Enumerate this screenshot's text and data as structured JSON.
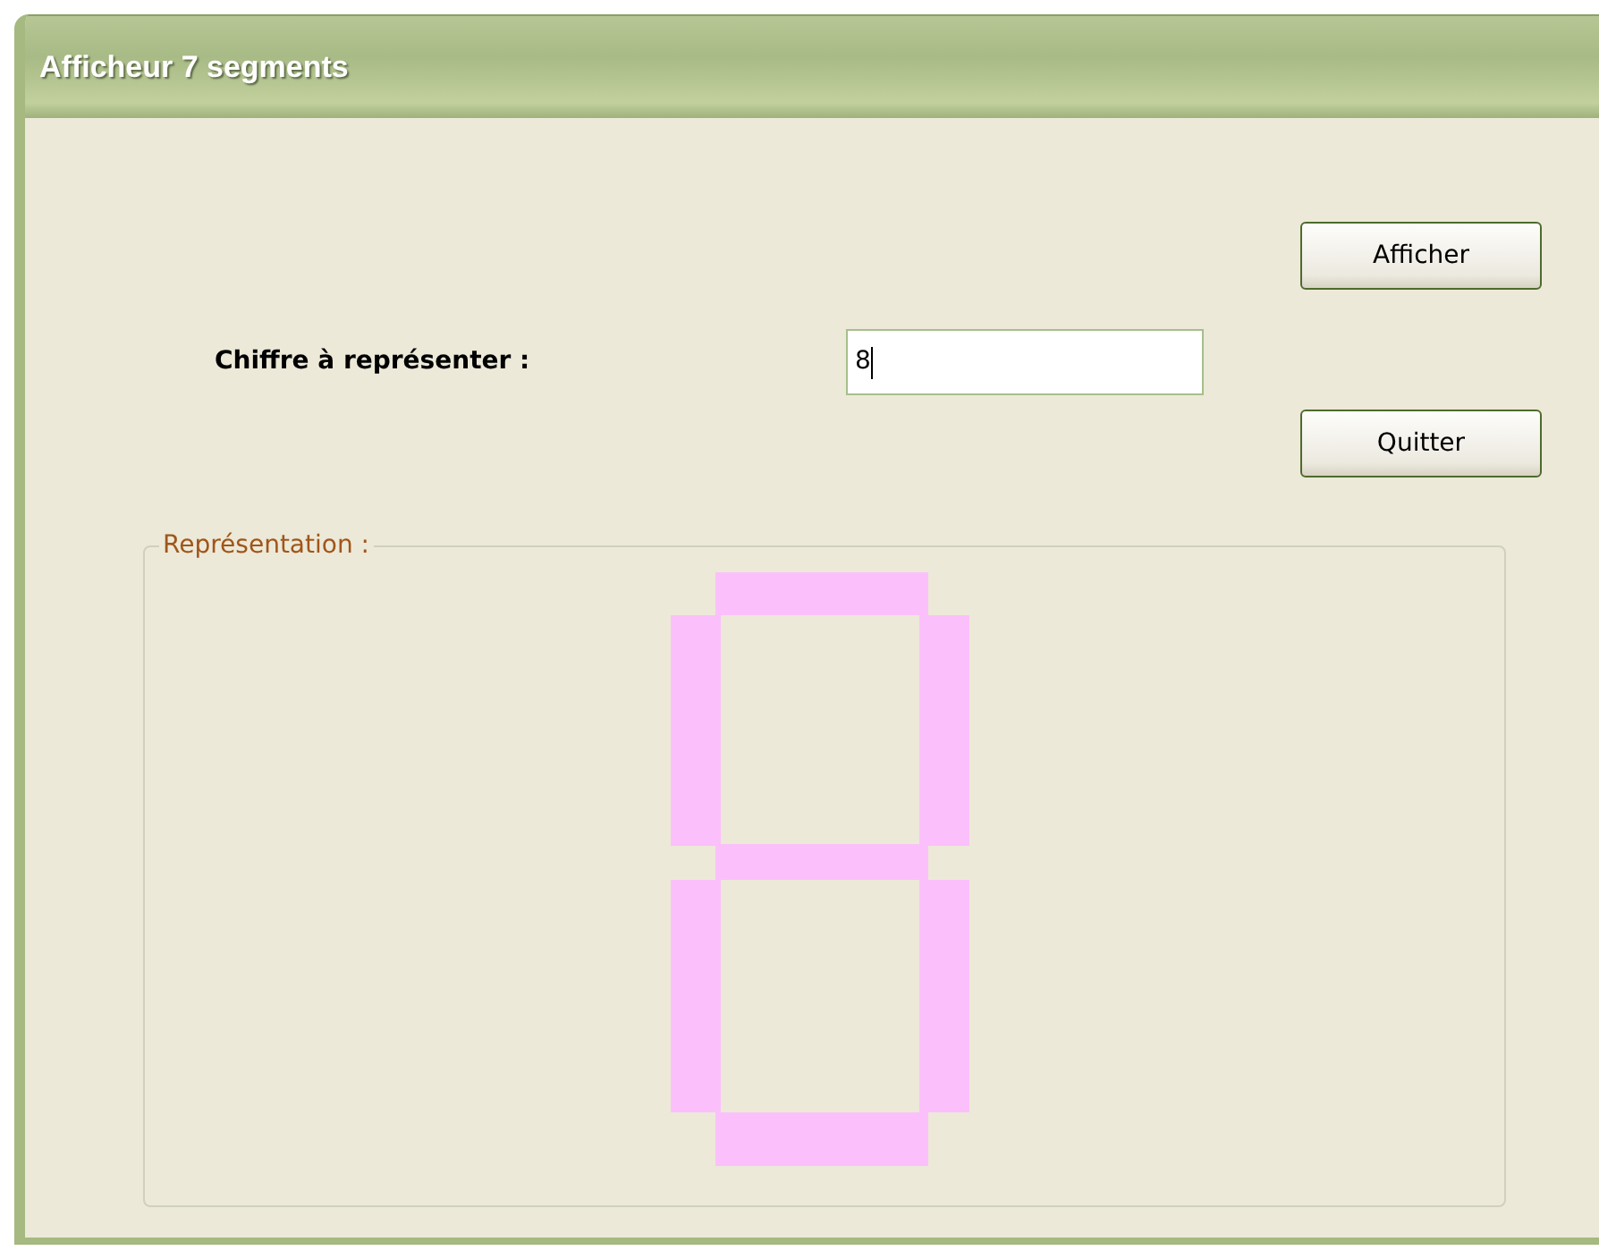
{
  "window": {
    "title": "Afficheur 7 segments"
  },
  "form": {
    "label": "Chiffre à représenter :",
    "value": "8"
  },
  "buttons": [
    {
      "label": "Afficher"
    },
    {
      "label": "Quitter"
    }
  ],
  "group": {
    "title": "Représentation :"
  },
  "segments": [
    {
      "kind": "top",
      "on": true
    },
    {
      "kind": "upper-left",
      "on": true
    },
    {
      "kind": "upper-right",
      "on": true
    },
    {
      "kind": "middle",
      "on": true
    },
    {
      "kind": "lower-left",
      "on": true
    },
    {
      "kind": "lower-right",
      "on": true
    },
    {
      "kind": "bottom",
      "on": true
    }
  ]
}
